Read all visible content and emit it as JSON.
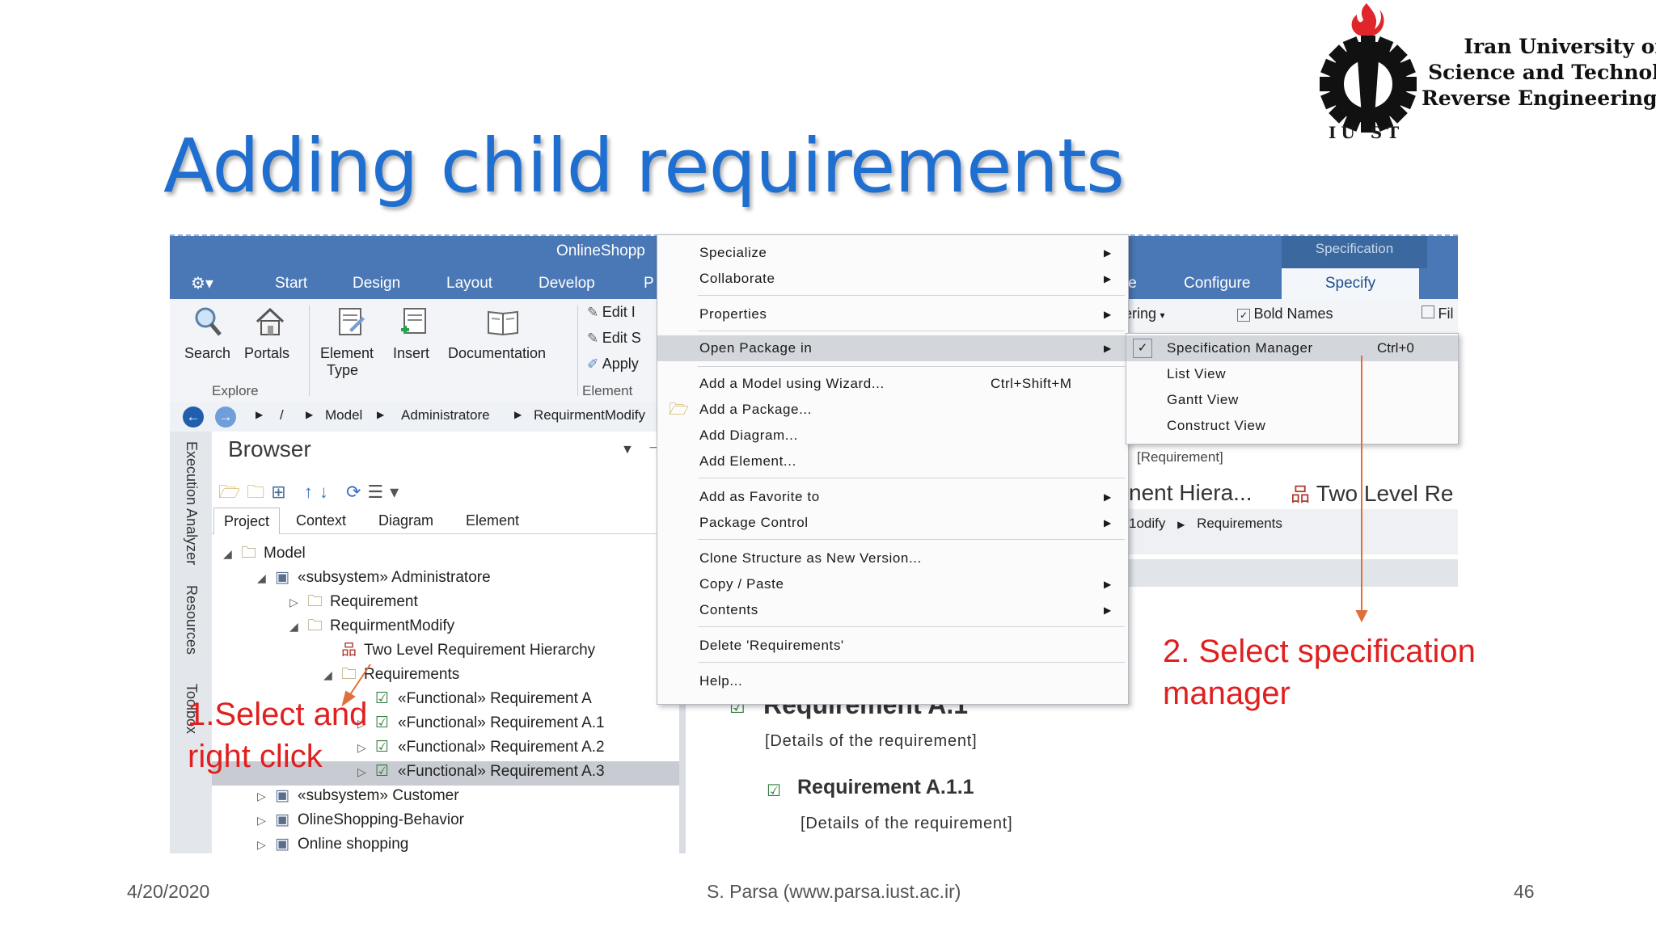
{
  "slide": {
    "title": "Adding child requirements",
    "date": "4/20/2020",
    "author": "S. Parsa (www.parsa.iust.ac.ir)",
    "page": "46",
    "logo": {
      "line1": "Iran University of",
      "line2": "Science and Technology",
      "line3": "Reverse Engineering Lab",
      "abbr": "IU ST"
    }
  },
  "app": {
    "window_title": "OnlineShopp",
    "context_tab": "Specification",
    "ribbon_tabs": [
      "Start",
      "Design",
      "Layout",
      "Develop",
      "P",
      "te",
      "Configure"
    ],
    "active_tab": "Specify",
    "ribbon": {
      "search": "Search",
      "portals": "Portals",
      "element_type_1": "Element",
      "element_type_2": "Type",
      "insert": "Insert",
      "documentation": "Documentation",
      "explore_group": "Explore",
      "element_group": "Element",
      "edit1": "Edit I",
      "edit2": "Edit S",
      "apply": "Apply",
      "ering": "ering",
      "bold_names": "Bold Names",
      "fil": "Fil"
    },
    "breadcrumb": [
      "/",
      "Model",
      "Administratore",
      "RequirmentModify"
    ],
    "left_rail": {
      "r1": "Execution Analyzer",
      "r2": "Resources",
      "r3": "Toolbox"
    },
    "browser": {
      "title": "Browser",
      "tabs": [
        "Project",
        "Context",
        "Diagram",
        "Element"
      ],
      "tree": [
        {
          "label": "Model",
          "tri": "◢",
          "icon": "🗀"
        },
        {
          "label": "«subsystem» Administratore",
          "tri": "◢",
          "icon": "▣"
        },
        {
          "label": "Requirement",
          "tri": "▷",
          "icon": "🗀"
        },
        {
          "label": "RequirmentModify",
          "tri": "◢",
          "icon": "🗀"
        },
        {
          "label": "Two Level Requirement Hierarchy",
          "tri": "",
          "icon": "品"
        },
        {
          "label": "Requirements",
          "tri": "◢",
          "icon": "🗀"
        },
        {
          "label": "«Functional» Requirement A",
          "tri": "",
          "icon": "☑"
        },
        {
          "label": "«Functional» Requirement A.1",
          "tri": "▷",
          "icon": "☑"
        },
        {
          "label": "«Functional» Requirement A.2",
          "tri": "▷",
          "icon": "☑"
        },
        {
          "label": "«Functional» Requirement A.3",
          "tri": "▷",
          "icon": "☑"
        },
        {
          "label": "«subsystem» Customer",
          "tri": "▷",
          "icon": "▣"
        },
        {
          "label": "OlineShopping-Behavior",
          "tri": "▷",
          "icon": "▣"
        },
        {
          "label": "Online shopping",
          "tri": "▷",
          "icon": "▣"
        }
      ]
    },
    "rhs": {
      "requirement_tag": "[Requirement]",
      "hier_tab": "nent Hiera...",
      "two_level_tab": "Two Level Re",
      "crumb1": "1odify",
      "crumb2": "Requirements",
      "doc_h1": "Requirement A.1",
      "doc_p1": "[Details of the requirement]",
      "doc_h2": "Requirement A.1.1",
      "doc_p2": "[Details of the requirement]"
    }
  },
  "context_menu": {
    "items": [
      {
        "label": "Specialize",
        "shortcut": "",
        "arrow": "▶"
      },
      {
        "label": "Collaborate",
        "shortcut": "",
        "arrow": "▶"
      },
      {
        "label": "Properties",
        "shortcut": "",
        "arrow": "▶"
      },
      {
        "label": "Open Package in",
        "shortcut": "",
        "arrow": "▶"
      },
      {
        "label": "Add a Model using Wizard...",
        "shortcut": "Ctrl+Shift+M",
        "arrow": ""
      },
      {
        "label": "Add a Package...",
        "shortcut": "",
        "arrow": ""
      },
      {
        "label": "Add Diagram...",
        "shortcut": "",
        "arrow": ""
      },
      {
        "label": "Add Element...",
        "shortcut": "",
        "arrow": ""
      },
      {
        "label": "Add as Favorite to",
        "shortcut": "",
        "arrow": "▶"
      },
      {
        "label": "Package Control",
        "shortcut": "",
        "arrow": "▶"
      },
      {
        "label": "Clone Structure as New Version...",
        "shortcut": "",
        "arrow": ""
      },
      {
        "label": "Copy / Paste",
        "shortcut": "",
        "arrow": "▶"
      },
      {
        "label": "Contents",
        "shortcut": "",
        "arrow": "▶"
      },
      {
        "label": "Delete 'Requirements'",
        "shortcut": "",
        "arrow": ""
      },
      {
        "label": "Help...",
        "shortcut": "",
        "arrow": ""
      }
    ]
  },
  "submenu": {
    "items": [
      {
        "label": "Specification Manager",
        "shortcut": "Ctrl+0"
      },
      {
        "label": "List View",
        "shortcut": ""
      },
      {
        "label": "Gantt View",
        "shortcut": ""
      },
      {
        "label": "Construct View",
        "shortcut": ""
      }
    ]
  },
  "annotations": {
    "step1_line1": "1.Select and",
    "step1_line2": "right click",
    "step2_line1": "2. Select specification",
    "step2_line2": "manager"
  },
  "colors": {
    "title_blue": "#1f6fd1",
    "ribbon_blue": "#4a77b5",
    "annotation_red": "#e02020",
    "arrow_orange": "#e0703a"
  }
}
